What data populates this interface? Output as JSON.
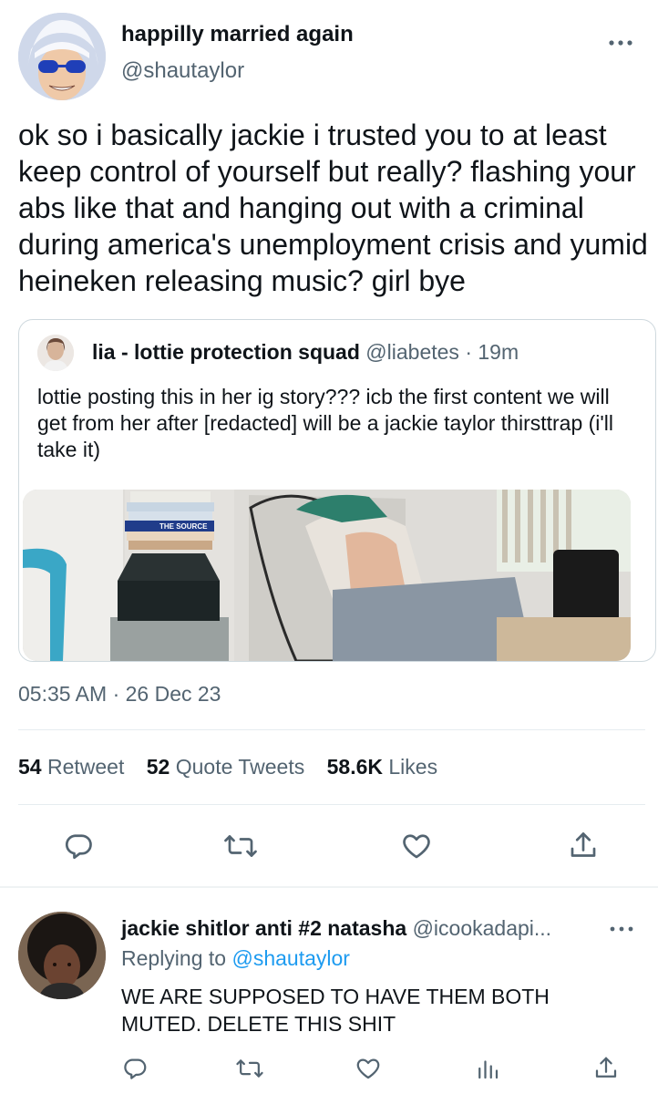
{
  "tweet": {
    "author_name": "happilly married again",
    "author_handle": "@shautaylor",
    "text": "ok so i basically jackie i trusted you to at least keep control of yourself but really? flashing your abs like that and hanging out with a criminal during america's unemployment crisis and yumid heineken releasing music? girl bye",
    "timestamp": "05:35 AM · 26 Dec 23"
  },
  "quote": {
    "author_name": "lia - lottie protection squad",
    "author_handle": "@liabetes",
    "time": "· 19m",
    "text": "lottie posting this in her ig story??? icb the first content we will get from her after [redacted] will be a jackie taylor thirsttrap (i'll take it)",
    "image_text": "THE SOURCE"
  },
  "stats": {
    "retweets_num": "54",
    "retweets_label": "Retweet",
    "quotes_num": "52",
    "quotes_label": "Quote Tweets",
    "likes_num": "58.6K",
    "likes_label": "Likes"
  },
  "reply": {
    "author_name": "jackie shitlor anti #2 natasha",
    "author_handle": "@icookadapi...",
    "replying_prefix": "Replying to",
    "replying_handle": "@shautaylor",
    "text": "WE ARE SUPPOSED TO HAVE THEM BOTH MUTED. DELETE THIS SHIT"
  },
  "icons": [
    "more-icon",
    "reply-icon",
    "retweet-icon",
    "like-icon",
    "share-icon",
    "analytics-icon"
  ],
  "colors": {
    "link": "#1d9bf0",
    "secondary": "#536471",
    "text": "#0f1419",
    "divider": "#e6ecf0"
  }
}
